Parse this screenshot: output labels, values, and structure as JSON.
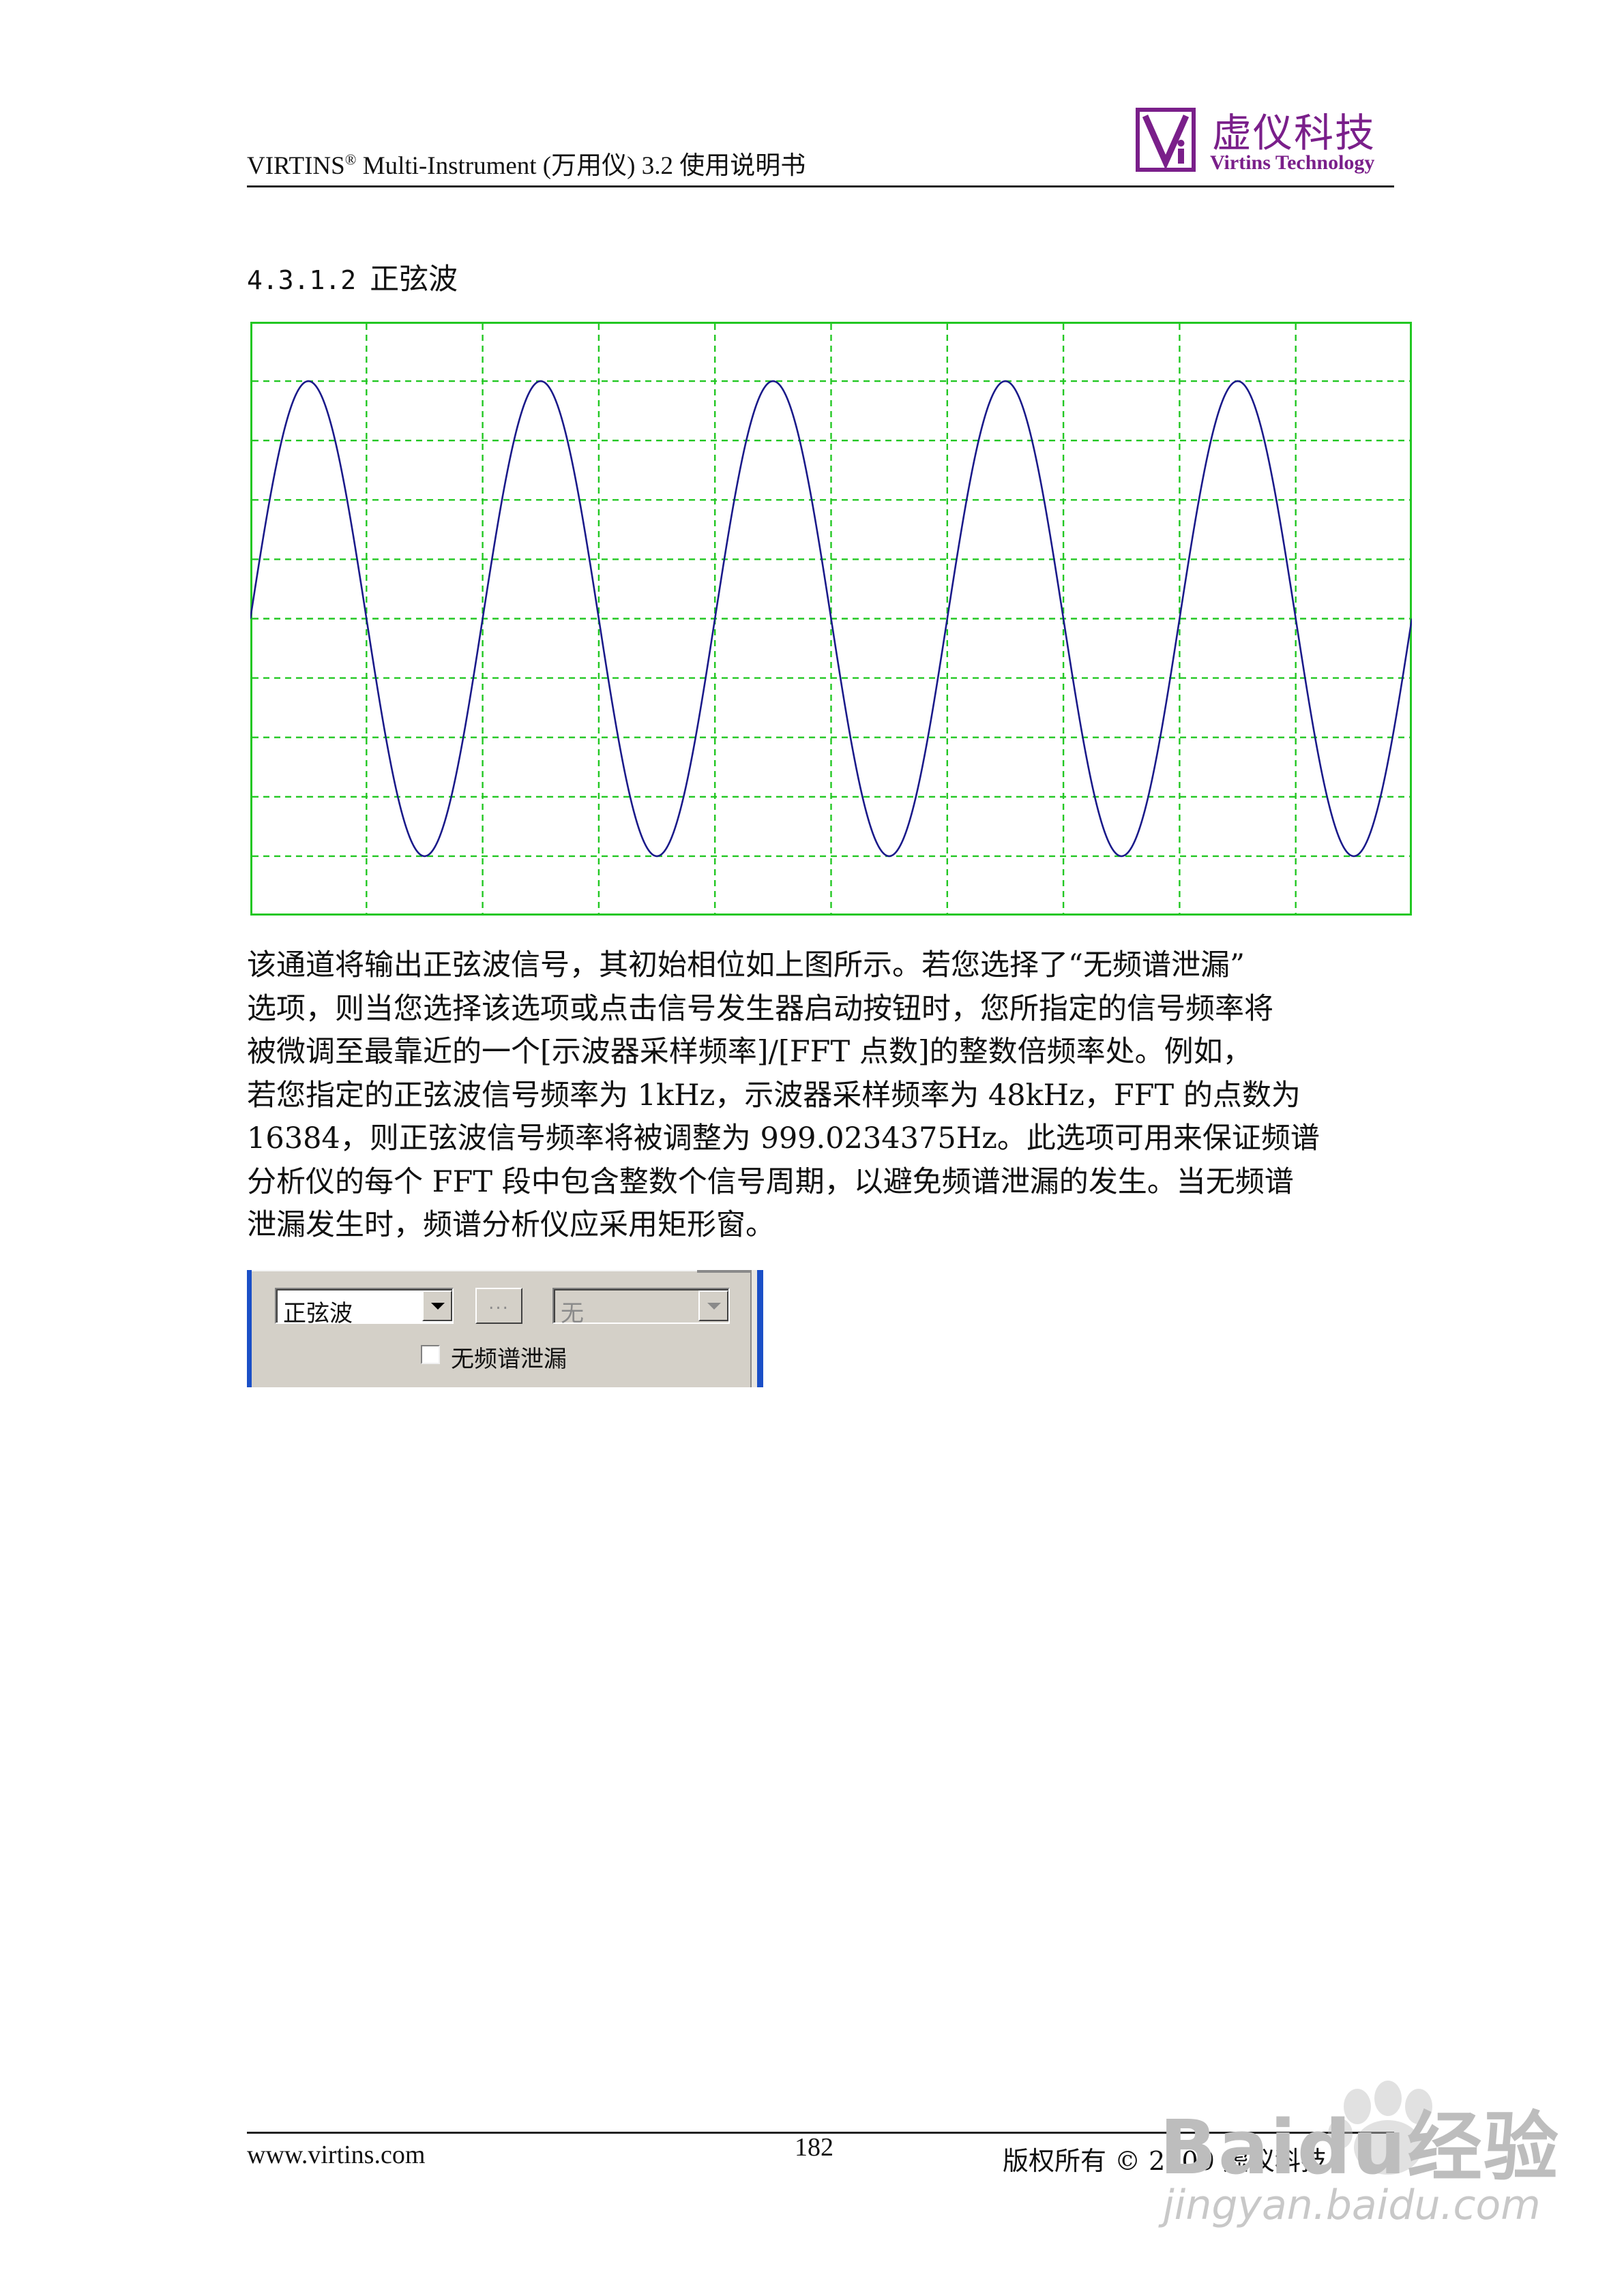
{
  "header": {
    "brand": "VIRTINS",
    "reg_mark": "®",
    "title_rest": " Multi-Instrument (万用仪) 3.2 使用说明书",
    "logo_cn": "虚仪科技",
    "logo_en": "Virtins Technology",
    "brand_color": "#7a1f8a"
  },
  "section": {
    "number": "4.3.1.2",
    "title": "正弦波"
  },
  "scope": {
    "grid_color": "#22c722",
    "trace_color": "#1a1a8a",
    "cycles": 5,
    "start_phase": "0 (rising from centre)"
  },
  "paragraph": {
    "lines": [
      "该通道将输出正弦波信号，其初始相位如上图所示。若您选择了“无频谱泄漏”",
      "选项，则当您选择该选项或点击信号发生器启动按钮时，您所指定的信号频率将",
      "被微调至最靠近的一个[示波器采样频率]/[FFT 点数]的整数倍频率处。例如，",
      "若您指定的正弦波信号频率为 1kHz，示波器采样频率为 48kHz，FFT 的点数为",
      "16384，则正弦波信号频率将被调整为 999.0234375Hz。此选项可用来保证频谱",
      "分析仪的每个 FFT 段中包含整数个信号周期，以避免频谱泄漏的发生。当无频谱",
      "泄漏发生时，频谱分析仪应采用矩形窗。"
    ]
  },
  "widget": {
    "waveform_value": "正弦波",
    "dots_label": "...",
    "second_value": "无",
    "checkbox_label": "无频谱泄漏",
    "checkbox_checked": false
  },
  "footer": {
    "website": "www.virtins.com",
    "page": "182",
    "copyright": "版权所有 © 2009 虚仪科技"
  },
  "watermark": {
    "text": "Baidu经验",
    "url": "jingyan.baidu.com"
  }
}
